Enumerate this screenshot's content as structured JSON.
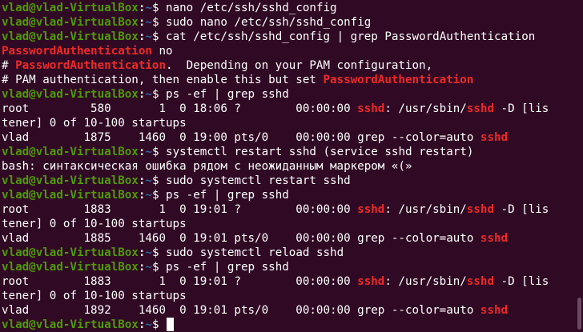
{
  "terminal": {
    "prompt_user": "vlad@vlad-VirtualBox",
    "prompt_path": "~",
    "lines": [
      {
        "kind": "prompt",
        "cmd": " nano /etc/ssh/sshd_config"
      },
      {
        "kind": "prompt",
        "cmd": " sudo nano /etc/ssh/sshd_config"
      },
      {
        "kind": "prompt",
        "cmd": " cat /etc/ssh/sshd_config | grep PasswordAuthentication"
      },
      {
        "kind": "out",
        "segs": [
          {
            "t": "PasswordAuthentication",
            "hl": true
          },
          {
            "t": " no"
          }
        ]
      },
      {
        "kind": "out",
        "segs": [
          {
            "t": "# "
          },
          {
            "t": "PasswordAuthentication",
            "hl": true
          },
          {
            "t": ".  Depending on your PAM configuration,"
          }
        ]
      },
      {
        "kind": "out",
        "segs": [
          {
            "t": "# PAM authentication, then enable this but set "
          },
          {
            "t": "PasswordAuthentication",
            "hl": true
          }
        ]
      },
      {
        "kind": "prompt",
        "cmd": " ps -ef | grep sshd"
      },
      {
        "kind": "out",
        "segs": [
          {
            "t": "root         580       1  0 18:06 ?        00:00:00 "
          },
          {
            "t": "sshd",
            "hl": true
          },
          {
            "t": ": /usr/sbin/"
          },
          {
            "t": "sshd",
            "hl": true
          },
          {
            "t": " -D [lis"
          }
        ]
      },
      {
        "kind": "out",
        "segs": [
          {
            "t": "tener] 0 of 10-100 startups"
          }
        ]
      },
      {
        "kind": "out",
        "segs": [
          {
            "t": "vlad        1875    1460  0 19:00 pts/0    00:00:00 grep --color=auto "
          },
          {
            "t": "sshd",
            "hl": true
          }
        ]
      },
      {
        "kind": "prompt",
        "cmd": " systemctl restart sshd (service sshd restart)"
      },
      {
        "kind": "out",
        "segs": [
          {
            "t": "bash: синтаксическая ошибка рядом с неожиданным маркером «(»"
          }
        ]
      },
      {
        "kind": "prompt",
        "cmd": " sudo systemctl restart sshd"
      },
      {
        "kind": "prompt",
        "cmd": " ps -ef | grep sshd"
      },
      {
        "kind": "out",
        "segs": [
          {
            "t": "root        1883       1  0 19:01 ?        00:00:00 "
          },
          {
            "t": "sshd",
            "hl": true
          },
          {
            "t": ": /usr/sbin/"
          },
          {
            "t": "sshd",
            "hl": true
          },
          {
            "t": " -D [lis"
          }
        ]
      },
      {
        "kind": "out",
        "segs": [
          {
            "t": "tener] 0 of 10-100 startups"
          }
        ]
      },
      {
        "kind": "out",
        "segs": [
          {
            "t": "vlad        1885    1460  0 19:01 pts/0    00:00:00 grep --color=auto "
          },
          {
            "t": "sshd",
            "hl": true
          }
        ]
      },
      {
        "kind": "prompt",
        "cmd": " sudo systemctl reload sshd"
      },
      {
        "kind": "prompt",
        "cmd": " ps -ef | grep sshd"
      },
      {
        "kind": "out",
        "segs": [
          {
            "t": "root        1883       1  0 19:01 ?        00:00:00 "
          },
          {
            "t": "sshd",
            "hl": true
          },
          {
            "t": ": /usr/sbin/"
          },
          {
            "t": "sshd",
            "hl": true
          },
          {
            "t": " -D [lis"
          }
        ]
      },
      {
        "kind": "out",
        "segs": [
          {
            "t": "tener] 0 of 10-100 startups"
          }
        ]
      },
      {
        "kind": "out",
        "segs": [
          {
            "t": "vlad        1892    1460  0 19:01 pts/0    00:00:00 grep --color=auto "
          },
          {
            "t": "sshd",
            "hl": true
          }
        ]
      },
      {
        "kind": "prompt",
        "cmd": " ",
        "cursor": true
      }
    ]
  },
  "colors": {
    "background": "#300a24",
    "prompt_user": "#4e9a06",
    "prompt_path": "#3465a4",
    "highlight": "#ef2929",
    "text": "#ffffff"
  }
}
